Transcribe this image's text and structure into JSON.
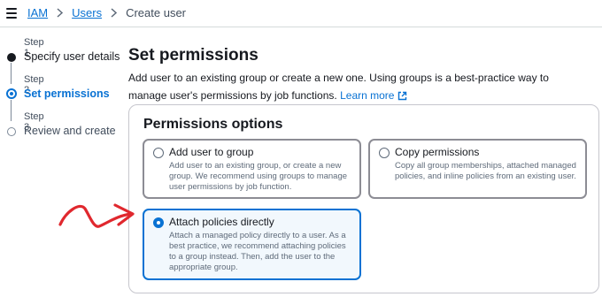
{
  "breadcrumb": {
    "items": [
      "IAM",
      "Users"
    ],
    "current": "Create user"
  },
  "steps": [
    {
      "number": "Step 1",
      "label": "Specify user details",
      "state": "done"
    },
    {
      "number": "Step 2",
      "label": "Set permissions",
      "state": "current"
    },
    {
      "number": "Step 3",
      "label": "Review and create",
      "state": "future"
    }
  ],
  "main": {
    "title": "Set permissions",
    "description": "Add user to an existing group or create a new one. Using groups is a best-practice way to manage user's permissions by job functions.",
    "learn_more": "Learn more"
  },
  "permissions": {
    "title": "Permissions options",
    "options": [
      {
        "title": "Add user to group",
        "description": "Add user to an existing group, or create a new group. We recommend using groups to manage user permissions by job function.",
        "selected": false
      },
      {
        "title": "Copy permissions",
        "description": "Copy all group memberships, attached managed policies, and inline policies from an existing user.",
        "selected": false
      },
      {
        "title": "Attach policies directly",
        "description": "Attach a managed policy directly to a user. As a best practice, we recommend attaching policies to a group instead. Then, add the user to the appropriate group.",
        "selected": true
      }
    ]
  },
  "colors": {
    "link": "#0972d3",
    "annotation_arrow": "#e0282e",
    "selected_tile_bg": "#f2f8fd"
  },
  "icons": {
    "menu": "hamburger-menu-icon",
    "separator": "chevron-right-icon",
    "external": "external-link-icon",
    "annotation": "red-arrow-annotation"
  }
}
